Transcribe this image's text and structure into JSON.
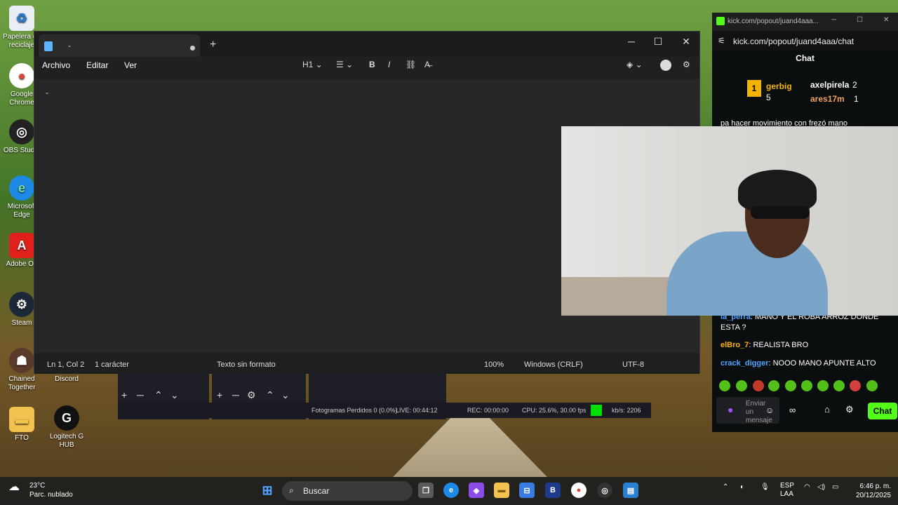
{
  "desktop": {
    "icons": [
      {
        "label": "Papelera de reciclaje"
      },
      {
        "label": "Google Chrome"
      },
      {
        "label": "OBS Studio"
      },
      {
        "label": "Microsoft Edge"
      },
      {
        "label": "Adobe Off"
      },
      {
        "label": "Steam"
      },
      {
        "label": "Chained Together"
      },
      {
        "label": "Discord"
      },
      {
        "label": "FTO"
      },
      {
        "label": "Logitech G HUB"
      }
    ]
  },
  "notepad": {
    "tab_title": "-",
    "menu": [
      "Archivo",
      "Editar",
      "Ver"
    ],
    "toolbar": {
      "heading": "H1",
      "bold": "B",
      "italic": "I"
    },
    "content": "-",
    "status": {
      "position": "Ln 1, Col 2",
      "chars": "1 carácter",
      "format": "Texto sin formato",
      "zoom": "100%",
      "line_ending": "Windows (CRLF)",
      "encoding": "UTF-8"
    }
  },
  "obs": {
    "frames": "Fotogramas Perdidos 0 (0.0%)",
    "live": "LIVE: 00:44:12",
    "rec": "REC: 00:00:00",
    "cpu": "CPU: 25.6%, 30.00 fps",
    "kbs": "kb/s: 2206"
  },
  "chat": {
    "window_title": "kick.com/popout/juand4aaa...",
    "url": "kick.com/popout/juand4aaa/chat",
    "header": "Chat",
    "leaderboard": {
      "top": {
        "name": "gerbig",
        "count": "5"
      },
      "second": {
        "name": "axelpirela",
        "count": "2"
      },
      "third": {
        "name": "ares17m",
        "count": "1"
      }
    },
    "pinned": "pa hacer movimiento con frezó mano",
    "messages": [
      {
        "user": "la_perra",
        "text": "MANO Y EL ROBA ARROZ DONDE ESTA ?"
      },
      {
        "user": "elBro_7",
        "text": "REALISTA BRO"
      },
      {
        "user": "crack_digger",
        "text": "NOOO MANO APUNTE ALTO"
      }
    ],
    "input_placeholder": "Enviar un mensaje",
    "send_label": "Chat"
  },
  "taskbar": {
    "weather_temp": "23°C",
    "weather_desc": "Parc. nublado",
    "search_label": "Buscar",
    "lang": "ESP",
    "lang2": "LAA",
    "time": "6:46 p. m.",
    "date": "20/12/2025"
  }
}
